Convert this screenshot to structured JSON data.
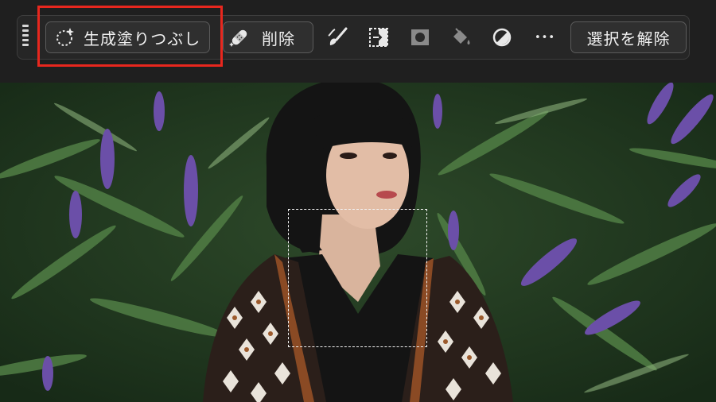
{
  "toolbar": {
    "generative_fill_label": "生成塗りつぶし",
    "remove_label": "削除",
    "deselect_label": "選択を解除",
    "more_label": "•••"
  },
  "icons": {
    "grip": "drag-handle-icon",
    "generative_fill": "sparkle-selection-icon",
    "remove": "bandage-remove-icon",
    "brush": "brush-icon",
    "transform": "select-transform-icon",
    "mask": "mask-icon",
    "fill": "paint-bucket-icon",
    "adjust": "half-circle-adjustment-icon"
  },
  "colors": {
    "highlight": "#e8271e",
    "toolbar_bg": "#262626"
  }
}
